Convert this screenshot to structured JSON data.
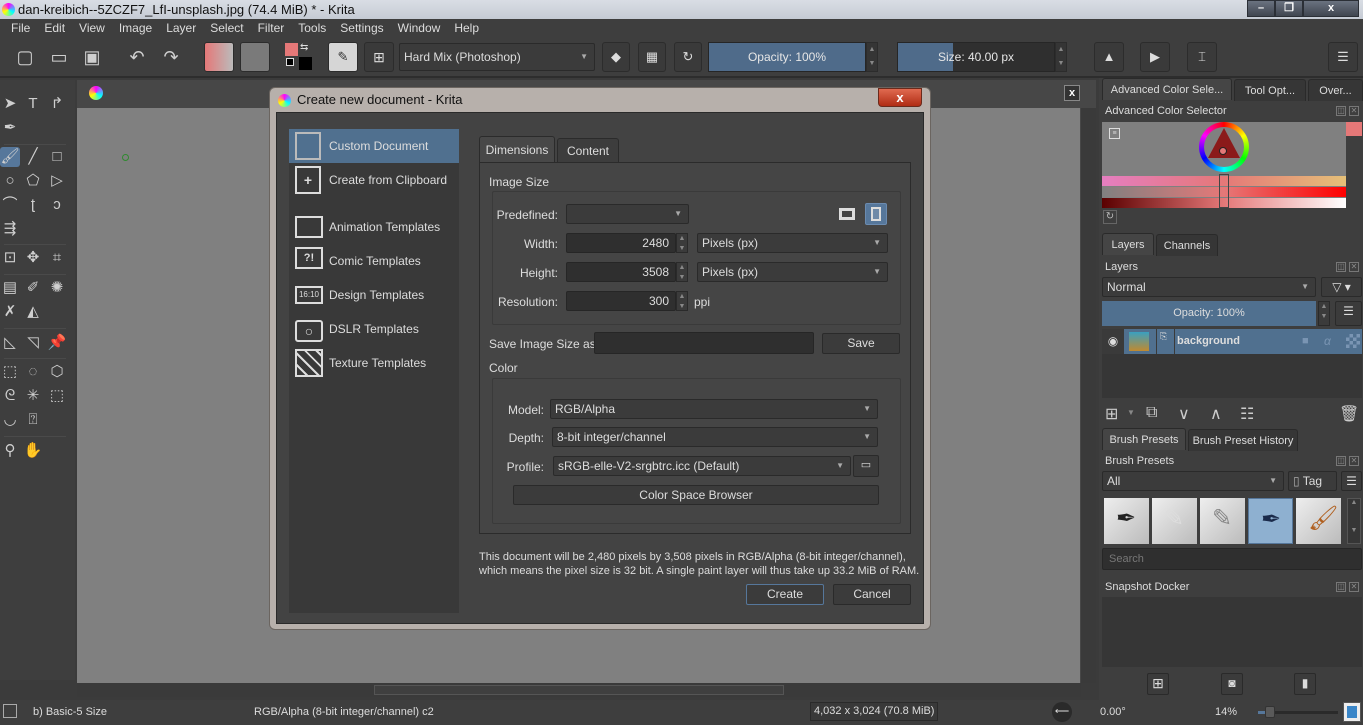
{
  "window": {
    "title": "dan-kreibich--5ZCZF7_LfI-unsplash.jpg (74.4 MiB)  * - Krita",
    "controls": {
      "minimize": "–",
      "maximize": "❐",
      "close": "x"
    }
  },
  "menu": [
    "File",
    "Edit",
    "View",
    "Image",
    "Layer",
    "Select",
    "Filter",
    "Tools",
    "Settings",
    "Window",
    "Help"
  ],
  "toolbar": {
    "blend_mode": "Hard Mix (Photoshop)",
    "opacity_label": "Opacity: 100%",
    "opacity_value": 1.0,
    "size_label": "Size: 40.00 px",
    "size_fraction": 0.35,
    "fg_color": "#e57878",
    "icons": [
      "new-document-icon",
      "open-document-icon",
      "save-icon",
      "undo-icon",
      "redo-icon",
      "gradient-icon",
      "pattern-icon",
      "color-swap-icon",
      "brush-preset-icon",
      "workspace-icon",
      "eraser-icon",
      "alpha-lock-icon",
      "reload-preset-icon",
      "mirror-horizontal-icon",
      "mirror-vertical-icon",
      "wrap-around-icon",
      "docker-menu-icon"
    ]
  },
  "toolbox": {
    "active_tool": "freehand-brush-tool"
  },
  "dialog": {
    "title": "Create new document - Krita",
    "close": "x",
    "sidebar": [
      {
        "label": "Custom Document",
        "icon": "custom-document-icon",
        "selected": true
      },
      {
        "label": "Create from Clipboard",
        "icon": "clipboard-icon",
        "selected": false
      },
      {
        "label": "Animation Templates",
        "icon": "animation-template-icon",
        "selected": false
      },
      {
        "label": "Comic Templates",
        "icon": "comic-template-icon",
        "selected": false,
        "glyph": "?!"
      },
      {
        "label": "Design Templates",
        "icon": "design-template-icon",
        "selected": false,
        "glyph": "16:10"
      },
      {
        "label": "DSLR Templates",
        "icon": "camera-icon",
        "selected": false
      },
      {
        "label": "Texture Templates",
        "icon": "texture-template-icon",
        "selected": false
      }
    ],
    "tabs": [
      {
        "label": "Dimensions",
        "selected": true
      },
      {
        "label": "Content",
        "selected": false
      }
    ],
    "image_size": {
      "group_label": "Image Size",
      "predefined_label": "Predefined:",
      "predefined_value": "",
      "width_label": "Width:",
      "width_value": "2480",
      "width_unit": "Pixels (px)",
      "height_label": "Height:",
      "height_value": "3508",
      "height_unit": "Pixels (px)",
      "resolution_label": "Resolution:",
      "resolution_value": "300",
      "resolution_unit": "ppi",
      "orientation": "portrait"
    },
    "save_size": {
      "label": "Save Image Size as:",
      "value": "",
      "button": "Save"
    },
    "color": {
      "group_label": "Color",
      "model_label": "Model:",
      "model_value": "RGB/Alpha",
      "depth_label": "Depth:",
      "depth_value": "8-bit integer/channel",
      "profile_label": "Profile:",
      "profile_value": "sRGB-elle-V2-srgbtrc.icc (Default)",
      "browser_button": "Color Space Browser"
    },
    "summary_line1": "This document will be 2,480 pixels by 3,508 pixels in RGB/Alpha (8-bit integer/channel),",
    "summary_line2": "which means the pixel size is 32 bit. A single paint layer will thus take up 33.2 MiB of RAM.",
    "create_button": "Create",
    "cancel_button": "Cancel"
  },
  "dockers": {
    "top_tabs": [
      {
        "label": "Advanced Color Sele...",
        "selected": true
      },
      {
        "label": "Tool Opt...",
        "selected": false
      },
      {
        "label": "Over...",
        "selected": false
      }
    ],
    "color_selector_title": "Advanced Color Selector",
    "layer_tabs": [
      {
        "label": "Layers",
        "selected": true
      },
      {
        "label": "Channels",
        "selected": false
      }
    ],
    "layers_title": "Layers",
    "blend_mode": "Normal",
    "layer_opacity": "Opacity:  100%",
    "layers": [
      {
        "name": "background",
        "visible": true
      }
    ],
    "brush_tabs": [
      {
        "label": "Brush Presets",
        "selected": true
      },
      {
        "label": "Brush Preset History",
        "selected": false
      }
    ],
    "brush_presets_title": "Brush Presets",
    "brush_filter": "All",
    "tag_label": "Tag",
    "search_placeholder": "Search",
    "snapshot_title": "Snapshot Docker"
  },
  "statusbar": {
    "brush": "b) Basic-5 Size",
    "color_space": "RGB/Alpha (8-bit integer/channel)  c2",
    "image_size": "4,032 x 3,024 (70.8 MiB)",
    "rotation": "0.00°",
    "zoom": "14%",
    "zoom_fraction": 0.15
  }
}
